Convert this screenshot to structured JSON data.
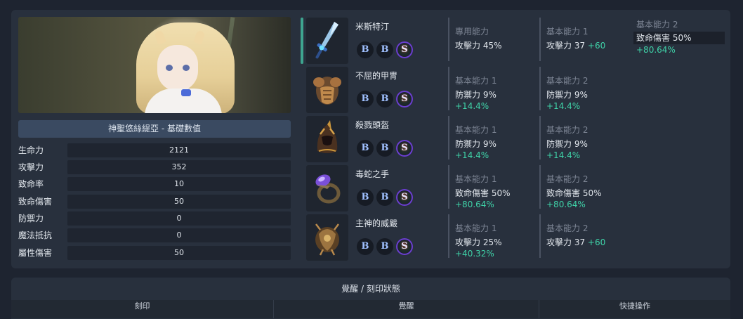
{
  "character": {
    "name_bar": "神聖悠絲緹亞 - 基礎數值",
    "stats": [
      {
        "label": "生命力",
        "value": "2121"
      },
      {
        "label": "攻擊力",
        "value": "352"
      },
      {
        "label": "致命率",
        "value": "10"
      },
      {
        "label": "致命傷害",
        "value": "50"
      },
      {
        "label": "防禦力",
        "value": "0"
      },
      {
        "label": "魔法抵抗",
        "value": "0"
      },
      {
        "label": "屬性傷害",
        "value": "50"
      }
    ]
  },
  "equipment": [
    {
      "name": "米斯特汀",
      "icon": "sword-icon",
      "runes": [
        "B",
        "B",
        "S"
      ],
      "props": [
        {
          "title": "專用能力",
          "text": "攻擊力 45%",
          "bonus": ""
        },
        {
          "title": "基本能力 1",
          "text": "攻擊力 37",
          "bonus": "+60"
        },
        {
          "title": "基本能力 2",
          "text": "致命傷害 50%",
          "bonus": "+80.64%"
        }
      ]
    },
    {
      "name": "不屈的甲冑",
      "icon": "armor-icon",
      "runes": [
        "B",
        "B",
        "S"
      ],
      "props": [
        {
          "title": "基本能力 1",
          "text": "防禦力 9%",
          "bonus": "+14.4%"
        },
        {
          "title": "基本能力 2",
          "text": "防禦力 9%",
          "bonus": "+14.4%"
        }
      ]
    },
    {
      "name": "殺戮頭盔",
      "icon": "helmet-icon",
      "runes": [
        "B",
        "B",
        "S"
      ],
      "props": [
        {
          "title": "基本能力 1",
          "text": "防禦力 9%",
          "bonus": "+14.4%"
        },
        {
          "title": "基本能力 2",
          "text": "防禦力 9%",
          "bonus": "+14.4%"
        }
      ]
    },
    {
      "name": "毒蛇之手",
      "icon": "ring-icon",
      "runes": [
        "B",
        "B",
        "S"
      ],
      "props": [
        {
          "title": "基本能力 1",
          "text": "致命傷害 50%",
          "bonus": "+80.64%"
        },
        {
          "title": "基本能力 2",
          "text": "致命傷害 50%",
          "bonus": "+80.64%"
        }
      ]
    },
    {
      "name": "主神的威嚴",
      "icon": "amulet-icon",
      "runes": [
        "B",
        "B",
        "S"
      ],
      "props": [
        {
          "title": "基本能力 1",
          "text": "攻擊力 25%",
          "bonus": "+40.32%"
        },
        {
          "title": "基本能力 2",
          "text": "攻擊力 37",
          "bonus": "+60"
        }
      ]
    }
  ],
  "bottom": {
    "title": "覺醒 / 刻印狀態",
    "columns": [
      "刻印",
      "覺醒",
      "快捷操作"
    ]
  },
  "colors": {
    "accent": "#3ea48f",
    "bonus": "#3fd2a8"
  }
}
